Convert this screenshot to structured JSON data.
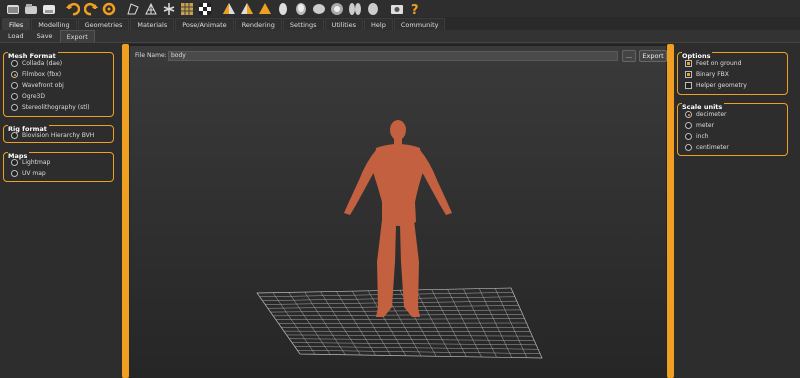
{
  "toolbar": {
    "icons": [
      "window-icon",
      "open-icon",
      "save-icon",
      "undo-icon",
      "redo-icon",
      "reset-icon",
      "smooth-icon",
      "wireframe-icon",
      "pose-icon",
      "grid-icon",
      "checker-icon",
      "front-view-icon",
      "back-view-icon",
      "left-view-icon",
      "right-view-icon",
      "top-view-icon",
      "bottom-view-icon",
      "reset-camera-icon",
      "screenshot-icon",
      "help-icon"
    ]
  },
  "main_tabs": [
    "Files",
    "Modelling",
    "Geometries",
    "Materials",
    "Pose/Animate",
    "Rendering",
    "Settings",
    "Utilities",
    "Help",
    "Community"
  ],
  "sub_tabs": [
    "Load",
    "Save",
    "Export"
  ],
  "left": {
    "mesh_format": {
      "title": "Mesh Format",
      "options": [
        {
          "label": "Collada (dae)",
          "selected": false
        },
        {
          "label": "Filmbox (fbx)",
          "selected": true
        },
        {
          "label": "Wavefront obj",
          "selected": false
        },
        {
          "label": "Ogre3D",
          "selected": false
        },
        {
          "label": "Stereolithography (stl)",
          "selected": false
        }
      ]
    },
    "rig_format": {
      "title": "Rig format",
      "options": [
        {
          "label": "Biovision Hierarchy BVH",
          "selected": false
        }
      ]
    },
    "maps": {
      "title": "Maps",
      "options": [
        {
          "label": "Lightmap",
          "selected": false
        },
        {
          "label": "UV map",
          "selected": false
        }
      ]
    }
  },
  "file": {
    "label": "File Name:",
    "value": "body",
    "browse_label": "...",
    "export_label": "Export"
  },
  "right": {
    "options": {
      "title": "Options",
      "items": [
        {
          "label": "Feet on ground",
          "checked": true
        },
        {
          "label": "Binary FBX",
          "checked": true
        },
        {
          "label": "Helper geometry",
          "checked": false
        }
      ]
    },
    "scale_units": {
      "title": "Scale units",
      "options": [
        {
          "label": "decimeter",
          "selected": true
        },
        {
          "label": "meter",
          "selected": false
        },
        {
          "label": "inch",
          "selected": false
        },
        {
          "label": "centimeter",
          "selected": false
        }
      ]
    }
  },
  "colors": {
    "accent": "#f0a020",
    "skin": "#c2603f"
  }
}
